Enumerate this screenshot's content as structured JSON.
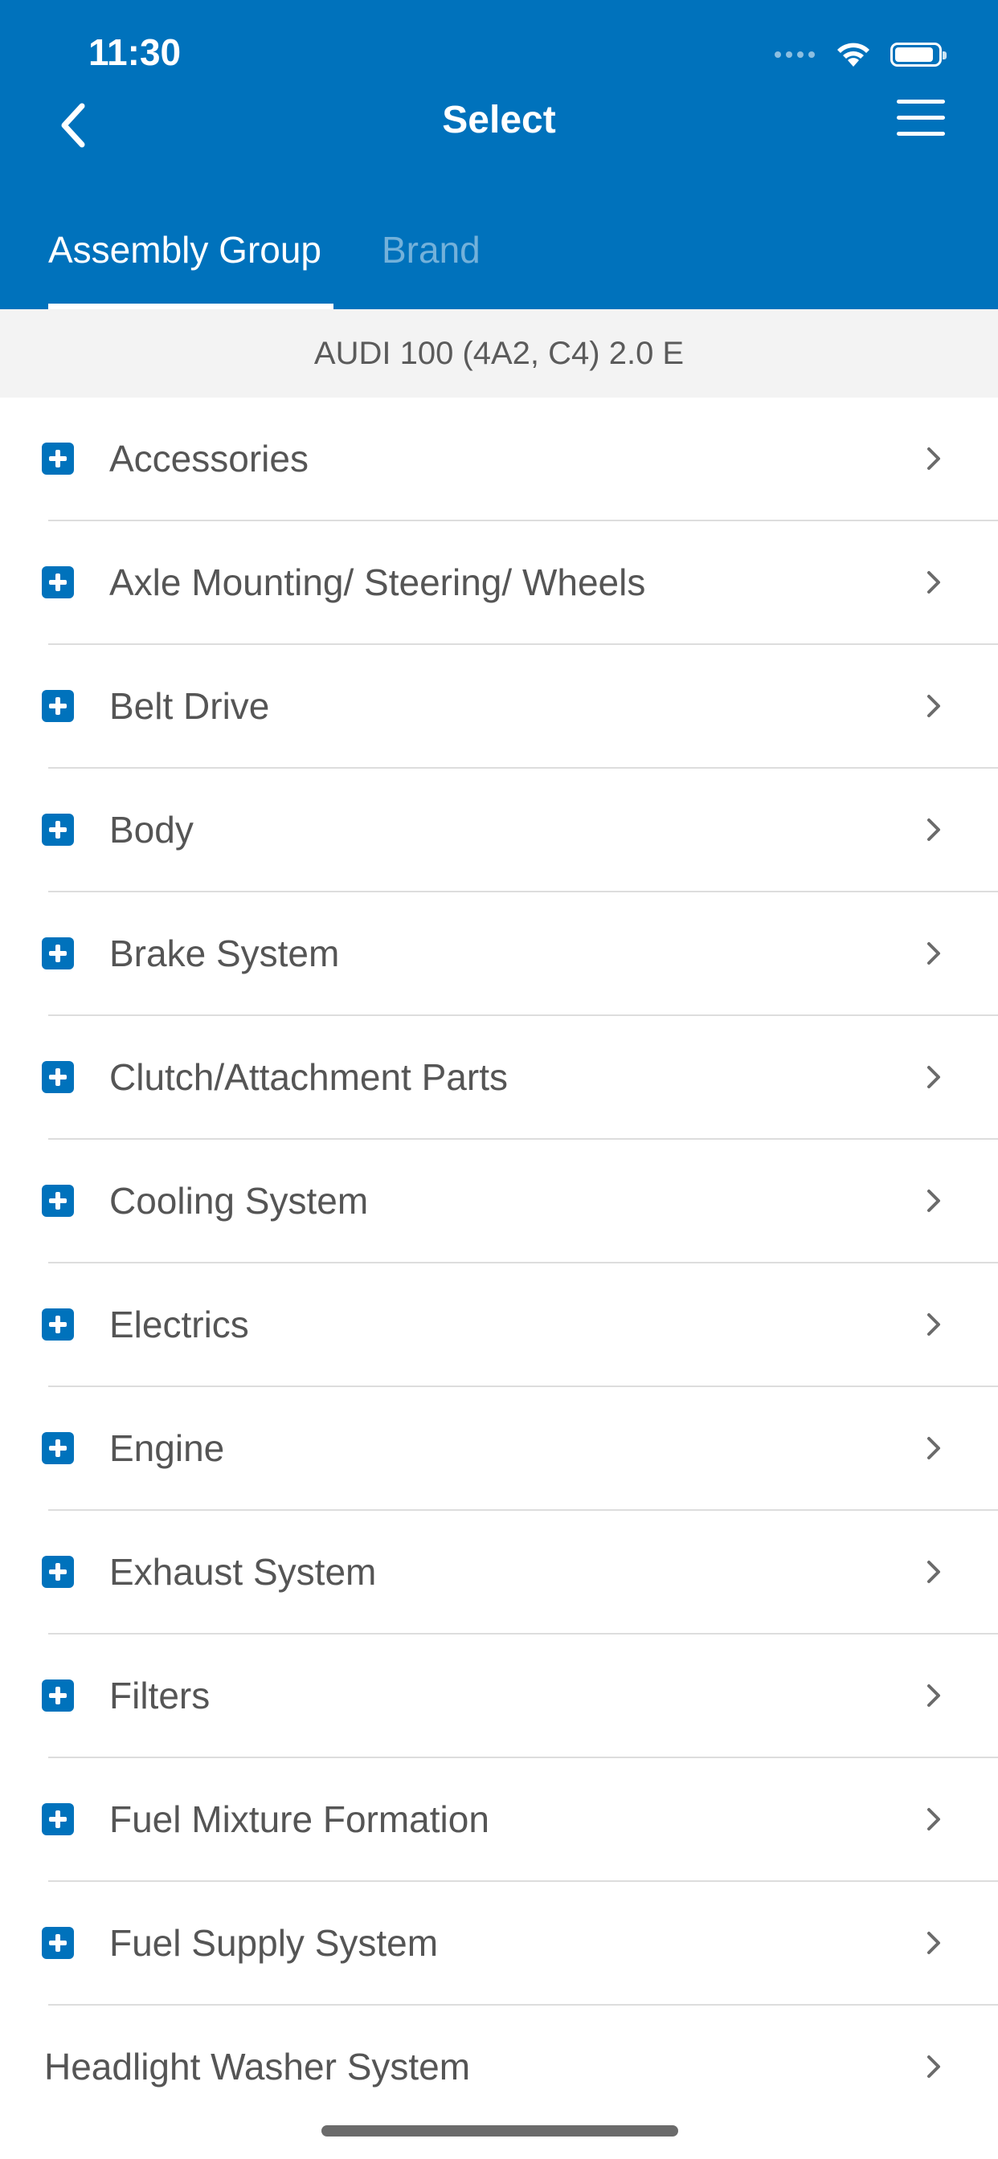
{
  "status_bar": {
    "time": "11:30"
  },
  "nav": {
    "title": "Select"
  },
  "tabs": [
    {
      "label": "Assembly Group",
      "active": true
    },
    {
      "label": "Brand",
      "active": false
    }
  ],
  "vehicle": {
    "label": "AUDI 100 (4A2, C4) 2.0 E"
  },
  "colors": {
    "brand_blue": "#0072bc",
    "text_gray": "#555555",
    "divider": "#dddddd"
  },
  "list": {
    "items": [
      {
        "label": "Accessories",
        "expandable": true
      },
      {
        "label": "Axle Mounting/ Steering/ Wheels",
        "expandable": true
      },
      {
        "label": "Belt Drive",
        "expandable": true
      },
      {
        "label": "Body",
        "expandable": true
      },
      {
        "label": "Brake System",
        "expandable": true
      },
      {
        "label": "Clutch/Attachment Parts",
        "expandable": true
      },
      {
        "label": "Cooling System",
        "expandable": true
      },
      {
        "label": "Electrics",
        "expandable": true
      },
      {
        "label": "Engine",
        "expandable": true
      },
      {
        "label": "Exhaust System",
        "expandable": true
      },
      {
        "label": "Filters",
        "expandable": true
      },
      {
        "label": "Fuel Mixture Formation",
        "expandable": true
      },
      {
        "label": "Fuel Supply System",
        "expandable": true
      },
      {
        "label": "Headlight Washer System",
        "expandable": false
      }
    ]
  }
}
